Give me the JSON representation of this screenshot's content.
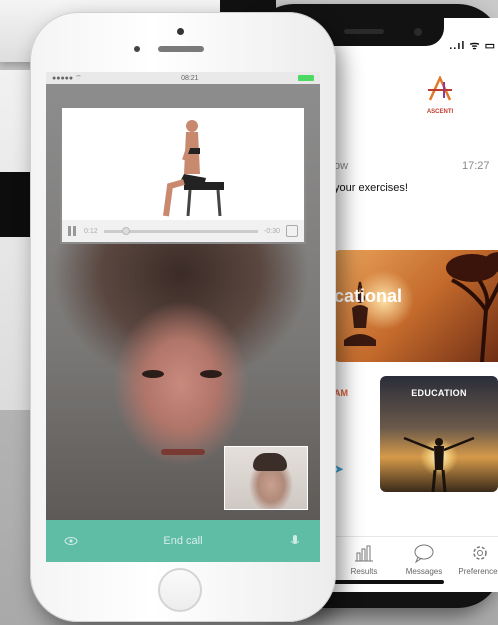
{
  "back_phone": {
    "status_icons": "..ıl ᯤ ▭",
    "logo": {
      "text": "ASCENTI",
      "sub": ""
    },
    "message": {
      "from": "ow",
      "time": "17:27",
      "text": "your exercises!"
    },
    "cards": {
      "yoga_label": "cational",
      "left_label": "AM",
      "education_label": "EDUCATION"
    },
    "tabs": [
      {
        "label": "Results",
        "icon": "chart-icon"
      },
      {
        "label": "Messages",
        "icon": "chat-bubble-icon"
      },
      {
        "label": "Preferences",
        "icon": "gear-icon"
      }
    ]
  },
  "front_phone": {
    "status": {
      "left": "●●●●● ⌔",
      "center": "08:21",
      "right": "1 ⨯ ⊙ ▬"
    },
    "video": {
      "elapsed": "0:12",
      "remaining": "-0:30"
    },
    "call_bar": {
      "end_label": "End call"
    }
  },
  "colors": {
    "accent_green": "#5ec4aa",
    "brand_red": "#c0392b",
    "orange": "#e0603a"
  }
}
